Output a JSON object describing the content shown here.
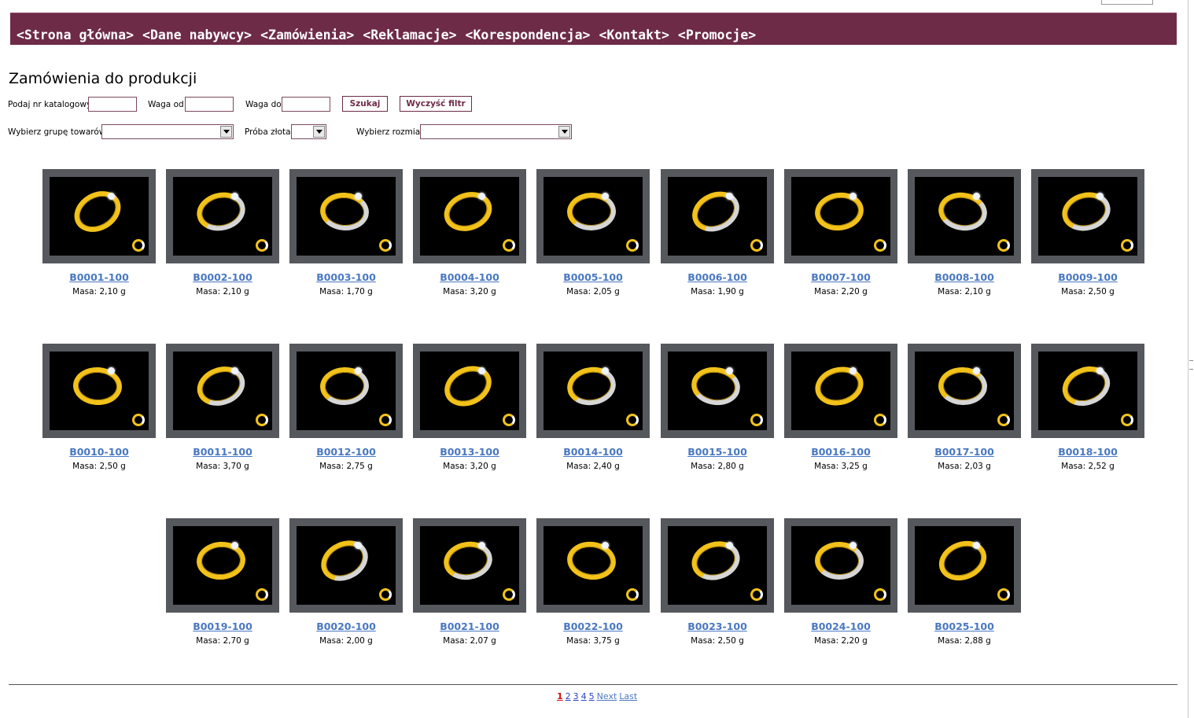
{
  "menu": {
    "items": [
      "<Strona główna>",
      "<Dane nabywcy>",
      "<Zamówienia>",
      "<Reklamacje>",
      "<Korespondencja>",
      "<Kontakt>",
      "<Promocje>"
    ]
  },
  "page_title": "Zamówienia do produkcji",
  "filters": {
    "catalog_label": "Podaj nr katalogowy",
    "weight_from_label": "Waga od",
    "weight_to_label": "Waga do",
    "search_label": "Szukaj",
    "clear_label": "Wyczyść filtr",
    "group_label": "Wybierz grupę towarów",
    "gold_label": "Próba złota",
    "size_label": "Wybierz rozmiar"
  },
  "products": [
    {
      "code": "B0001-100",
      "mass": "Masa: 2,10 g"
    },
    {
      "code": "B0002-100",
      "mass": "Masa: 2,10 g"
    },
    {
      "code": "B0003-100",
      "mass": "Masa: 1,70 g"
    },
    {
      "code": "B0004-100",
      "mass": "Masa: 3,20 g"
    },
    {
      "code": "B0005-100",
      "mass": "Masa: 2,05 g"
    },
    {
      "code": "B0006-100",
      "mass": "Masa: 1,90 g"
    },
    {
      "code": "B0007-100",
      "mass": "Masa: 2,20 g"
    },
    {
      "code": "B0008-100",
      "mass": "Masa: 2,10 g"
    },
    {
      "code": "B0009-100",
      "mass": "Masa: 2,50 g"
    },
    {
      "code": "B0010-100",
      "mass": "Masa: 2,50 g"
    },
    {
      "code": "B0011-100",
      "mass": "Masa: 3,70 g"
    },
    {
      "code": "B0012-100",
      "mass": "Masa: 2,75 g"
    },
    {
      "code": "B0013-100",
      "mass": "Masa: 3,20 g"
    },
    {
      "code": "B0014-100",
      "mass": "Masa: 2,40 g"
    },
    {
      "code": "B0015-100",
      "mass": "Masa: 2,80 g"
    },
    {
      "code": "B0016-100",
      "mass": "Masa: 3,25 g"
    },
    {
      "code": "B0017-100",
      "mass": "Masa: 2,03 g"
    },
    {
      "code": "B0018-100",
      "mass": "Masa: 2,52 g"
    },
    {
      "code": "B0019-100",
      "mass": "Masa: 2,70 g"
    },
    {
      "code": "B0020-100",
      "mass": "Masa: 2,00 g"
    },
    {
      "code": "B0021-100",
      "mass": "Masa: 2,07 g"
    },
    {
      "code": "B0022-100",
      "mass": "Masa: 3,75 g"
    },
    {
      "code": "B0023-100",
      "mass": "Masa: 2,50 g"
    },
    {
      "code": "B0024-100",
      "mass": "Masa: 2,20 g"
    },
    {
      "code": "B0025-100",
      "mass": "Masa: 2,88 g"
    }
  ],
  "pagination": {
    "current": "1",
    "pages": [
      "2",
      "3",
      "4",
      "5"
    ],
    "next": "Next",
    "last": "Last"
  },
  "colors": {
    "menu_bg": "#6d2b47",
    "link": "#4a78c2",
    "current_page": "#cc1111"
  }
}
